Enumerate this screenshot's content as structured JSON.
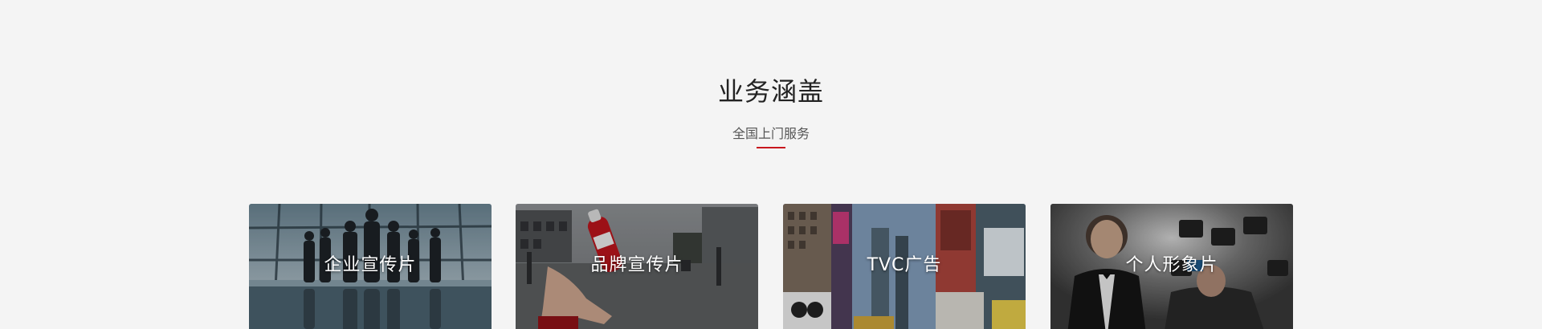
{
  "section": {
    "title": "业务涵盖",
    "subtitle": "全国上门服务",
    "accent_color": "#c8161d"
  },
  "cards": [
    {
      "label": "企业宣传片",
      "image": "business-team-silhouette-photo"
    },
    {
      "label": "品牌宣传片",
      "image": "hand-tossing-cola-bottle-street-photo"
    },
    {
      "label": "TVC广告",
      "image": "times-square-billboards-photo"
    },
    {
      "label": "个人形象片",
      "image": "man-in-tuxedo-photographers-photo"
    }
  ]
}
